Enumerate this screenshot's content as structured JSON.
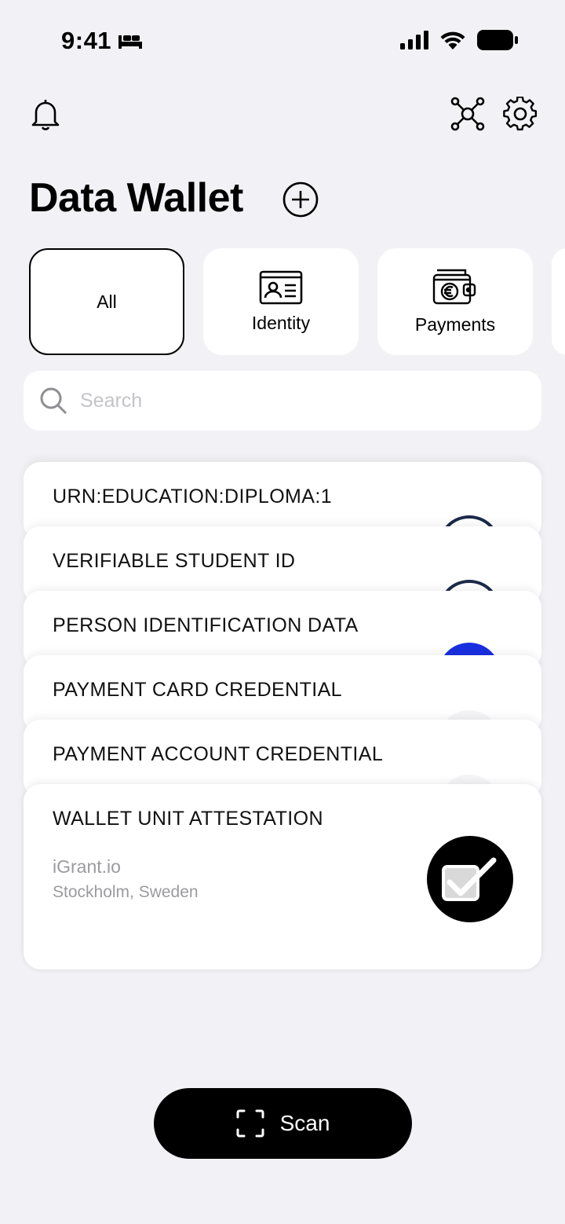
{
  "status_bar": {
    "time": "9:41",
    "icons": [
      "bed-icon",
      "signal-icon",
      "wifi-icon",
      "battery-icon"
    ]
  },
  "top_bar": {
    "icons": [
      "bell-icon",
      "connections-icon",
      "gear-icon"
    ]
  },
  "page": {
    "title": "Data Wallet",
    "add_icon": "plus-circle-icon"
  },
  "categories": [
    {
      "label": "All",
      "active": true
    },
    {
      "label": "Identity",
      "icon": "id-card-icon"
    },
    {
      "label": "Payments",
      "icon": "euro-wallet-icon"
    }
  ],
  "search": {
    "placeholder": "Search",
    "icon": "search-icon"
  },
  "cards": [
    {
      "title": "URN:EDUCATION:DIPLOMA:1"
    },
    {
      "title": "VERIFIABLE STUDENT ID"
    },
    {
      "title": "PERSON IDENTIFICATION DATA"
    },
    {
      "title": "PAYMENT CARD CREDENTIAL"
    },
    {
      "title": "PAYMENT ACCOUNT CREDENTIAL"
    },
    {
      "title": "WALLET UNIT ATTESTATION",
      "issuer": "iGrant.io",
      "location": "Stockholm, Sweden"
    }
  ],
  "scan": {
    "label": "Scan",
    "icon": "scan-frame-icon"
  },
  "colors": {
    "background": "#f2f2f6",
    "card": "#ffffff",
    "accent": "#000000",
    "pid_logo_blue": "#1a2fe0",
    "edu_logo_navy": "#1b2a4a",
    "muted_text": "#9b9b9f"
  }
}
